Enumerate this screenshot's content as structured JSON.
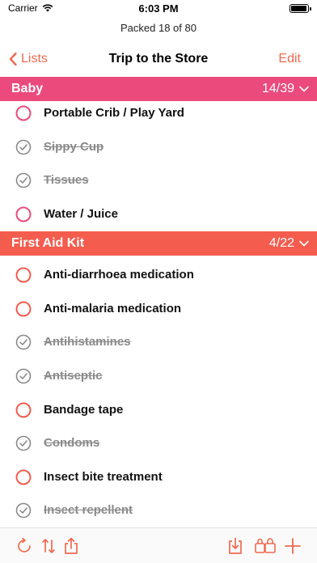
{
  "status_bar": {
    "carrier": "Carrier",
    "time": "6:03 PM"
  },
  "header": {
    "packed_text": "Packed 18 of 80"
  },
  "navbar": {
    "back_label": "Lists",
    "title": "Trip to the Store",
    "edit_label": "Edit"
  },
  "colors": {
    "accent": "#ee6a4f",
    "baby_header": "#ea4a7c",
    "first_aid_header": "#f45c4e",
    "checked_gray": "#8a8a8a"
  },
  "sections": [
    {
      "name": "Baby",
      "count": "14/39",
      "items": [
        {
          "label": "Portable Crib / Play Yard",
          "packed": false
        },
        {
          "label": "Sippy Cup",
          "packed": true
        },
        {
          "label": "Tissues",
          "packed": true
        },
        {
          "label": "Water / Juice",
          "packed": false
        }
      ]
    },
    {
      "name": "First Aid Kit",
      "count": "4/22",
      "items": [
        {
          "label": "Anti-diarrhoea medication",
          "packed": false
        },
        {
          "label": "Anti-malaria medication",
          "packed": false
        },
        {
          "label": "Antihistamines",
          "packed": true
        },
        {
          "label": "Antiseptic",
          "packed": true
        },
        {
          "label": "Bandage tape",
          "packed": false
        },
        {
          "label": "Condoms",
          "packed": true
        },
        {
          "label": "Insect bite treatment",
          "packed": false
        },
        {
          "label": "Insect repellent",
          "packed": true
        }
      ]
    }
  ],
  "toolbar": {
    "icons": [
      "refresh-icon",
      "sort-icon",
      "share-icon",
      "download-icon",
      "bags-icon",
      "add-icon"
    ]
  }
}
